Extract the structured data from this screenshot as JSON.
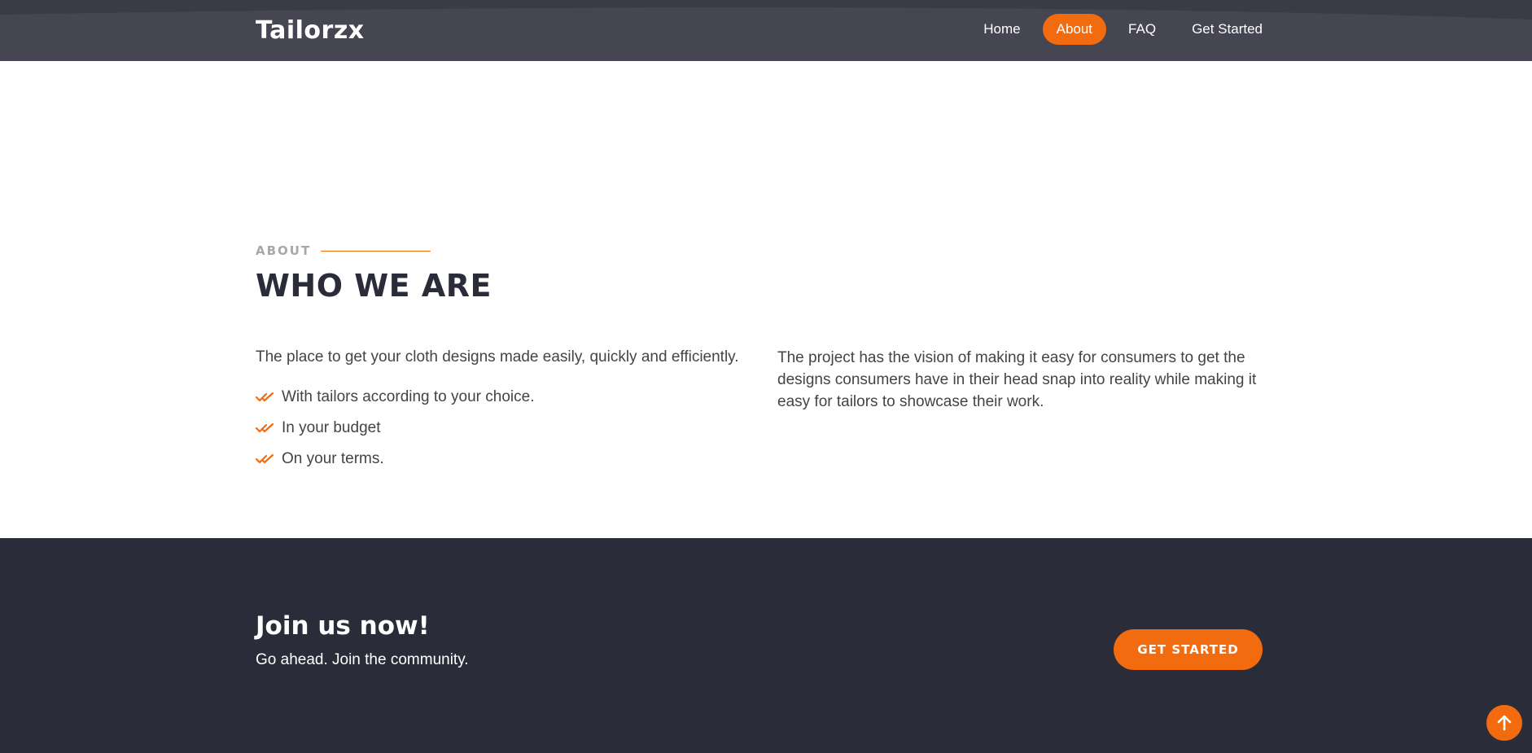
{
  "header": {
    "logo": "Tailorzx",
    "nav": [
      {
        "label": "Home"
      },
      {
        "label": "About"
      },
      {
        "label": "FAQ"
      },
      {
        "label": "Get Started"
      }
    ],
    "active_nav": "About"
  },
  "about": {
    "tag": "ABOUT",
    "title": "WHO WE ARE",
    "intro": "The place to get your cloth designs made easily, quickly and efficiently.",
    "list": [
      "With tailors according to your choice.",
      "In your budget",
      "On your terms."
    ],
    "description": "The project has the vision of making it easy for consumers to get the designs consumers have in their head snap into reality while making it easy for tailors to showcase their work."
  },
  "cta": {
    "title": "Join us now!",
    "subtitle": "Go ahead. Join the community.",
    "button": "GET STARTED"
  },
  "icons": {
    "list_bullet": "double-check-icon",
    "back_to_top": "arrow-up-icon"
  },
  "colors": {
    "accent": "#f26b0f",
    "header_bg": "#454651",
    "dark_bg": "#2b2c3a",
    "heading": "#2b2c3a",
    "text": "#444444",
    "muted": "#a8a8a8"
  }
}
